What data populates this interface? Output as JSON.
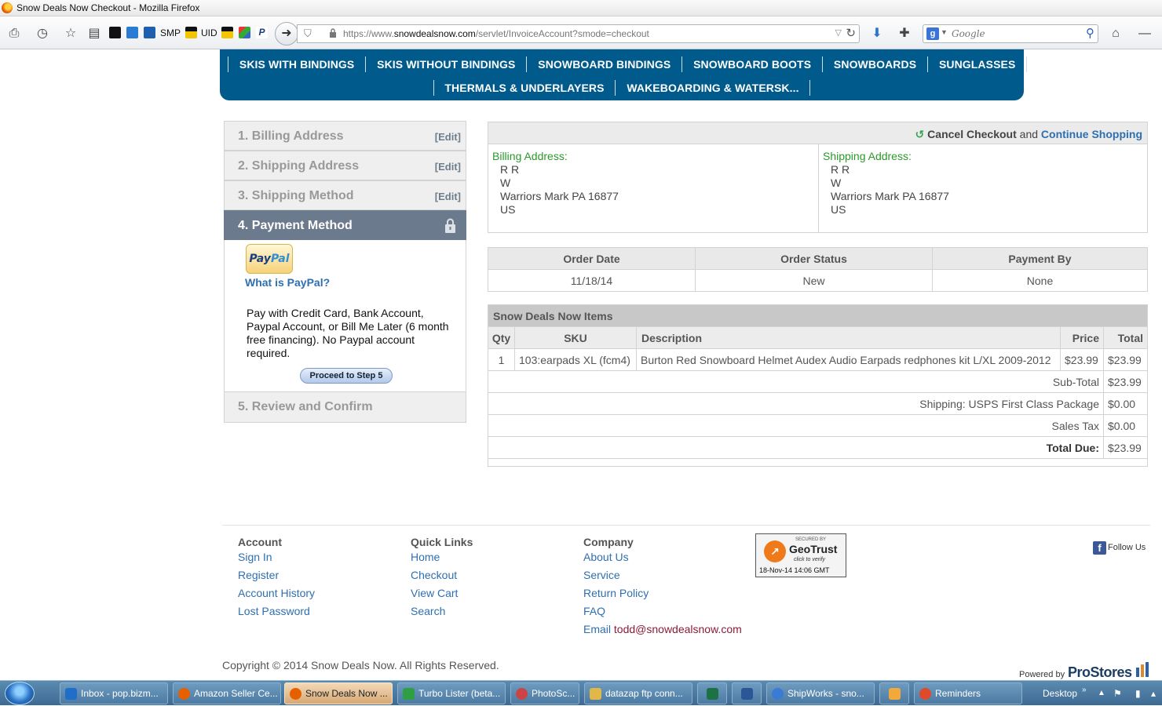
{
  "window": {
    "title": "Snow Deals Now Checkout - Mozilla Firefox"
  },
  "bookmarks": {
    "smp": "SMP",
    "uid": "UID"
  },
  "urlbar": {
    "prefix": "https://www.",
    "domain": "snowdealsnow.com",
    "path": "/servlet/InvoiceAccount?smode=checkout"
  },
  "search": {
    "placeholder": "Google"
  },
  "categories": {
    "row1": [
      "SKIS WITH BINDINGS",
      "SKIS WITHOUT BINDINGS",
      "SNOWBOARD BINDINGS",
      "SNOWBOARD BOOTS",
      "SNOWBOARDS",
      "SUNGLASSES"
    ],
    "row2": [
      "THERMALS & UNDERLAYERS",
      "WAKEBOARDING & WATERSK..."
    ]
  },
  "steps": {
    "s1": "1. Billing Address",
    "s2": "2. Shipping Address",
    "s3": "3. Shipping Method",
    "s4": "4. Payment Method",
    "s5": "5. Review and Confirm",
    "edit": "[Edit]",
    "paypal_logo_a": "Pay",
    "paypal_logo_b": "Pal",
    "what_is_paypal": "What is PayPal?",
    "pay_description": "Pay with Credit Card, Bank Account, Paypal Account, or Bill Me Later (6 month free financing). No Paypal account required.",
    "proceed_button": "Proceed to Step 5"
  },
  "header_links": {
    "cancel": "Cancel Checkout",
    "and": "and",
    "continue": "Continue Shopping"
  },
  "billing": {
    "title": "Billing Address:",
    "name": "R R",
    "line1": "W",
    "city": "Warriors Mark PA 16877",
    "country": "US"
  },
  "shipping": {
    "title": "Shipping Address:",
    "name": "R R",
    "line1": "W",
    "city": "Warriors Mark PA 16877",
    "country": "US"
  },
  "order": {
    "headers": [
      "Order Date",
      "Order Status",
      "Payment By"
    ],
    "values": [
      "11/18/14",
      "New",
      "None"
    ]
  },
  "items": {
    "caption": "Snow Deals Now Items",
    "headers": [
      "Qty",
      "SKU",
      "Description",
      "Price",
      "Total"
    ],
    "row": {
      "qty": "1",
      "sku": "103:earpads XL (fcm4)",
      "description": "Burton Red Snowboard Helmet Audex Audio Earpads redphones kit L/XL 2009-2012",
      "price": "$23.99",
      "total": "$23.99"
    },
    "subtotal_label": "Sub-Total",
    "subtotal": "$23.99",
    "shipping_label": "Shipping: USPS First Class Package",
    "shipping": "$0.00",
    "tax_label": "Sales Tax",
    "tax": "$0.00",
    "total_label": "Total Due:",
    "total": "$23.99"
  },
  "footer": {
    "account": {
      "heading": "Account",
      "links": [
        "Sign In",
        "Register",
        "Account History",
        "Lost Password"
      ]
    },
    "quick": {
      "heading": "Quick Links",
      "links": [
        "Home",
        "Checkout",
        "View Cart",
        "Search"
      ]
    },
    "company": {
      "heading": "Company",
      "links": [
        "About Us",
        "Service",
        "Return Policy",
        "FAQ"
      ],
      "email_label": "Email",
      "email": "todd@snowdealsnow.com"
    },
    "geotrust": {
      "secured": "SECURED BY",
      "name": "GeoTrust",
      "click": "click to verify",
      "date": "18-Nov-14 14:06 GMT"
    },
    "follow": "Follow Us",
    "copyright": "Copyright © 2014 Snow Deals Now. All Rights Reserved.",
    "powered_by": "Powered by",
    "prostores": "ProStores"
  },
  "taskbar": {
    "items": [
      "Inbox - pop.bizm...",
      "Amazon Seller Ce...",
      "Snow Deals Now ...",
      "Turbo Lister (beta...",
      "PhotoSc...",
      "datazap ftp conn...",
      "ShipWorks - sno...",
      "Reminders"
    ],
    "desktop": "Desktop"
  }
}
